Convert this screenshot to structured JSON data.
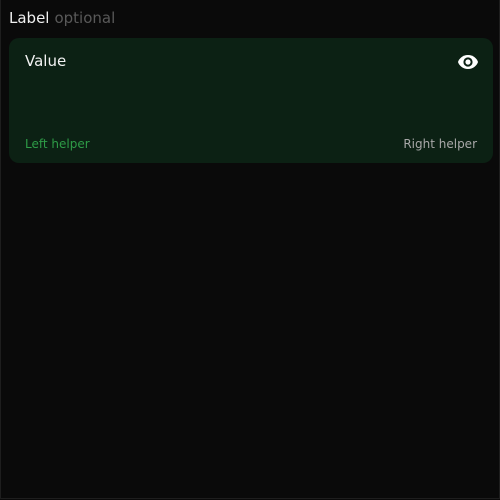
{
  "field": {
    "label": "Label",
    "optional_text": "optional",
    "value": "Value",
    "left_helper": "Left helper",
    "right_helper": "Right helper",
    "toggle_icon": "eye-icon"
  },
  "colors": {
    "background": "#0a0a0a",
    "field_background": "#0c2114",
    "label_text": "#f0f0f0",
    "optional_text": "#595959",
    "value_text": "#f2f2f2",
    "left_helper_text": "#2e9c47",
    "right_helper_text": "#a8a8a8",
    "icon": "#ffffff"
  }
}
